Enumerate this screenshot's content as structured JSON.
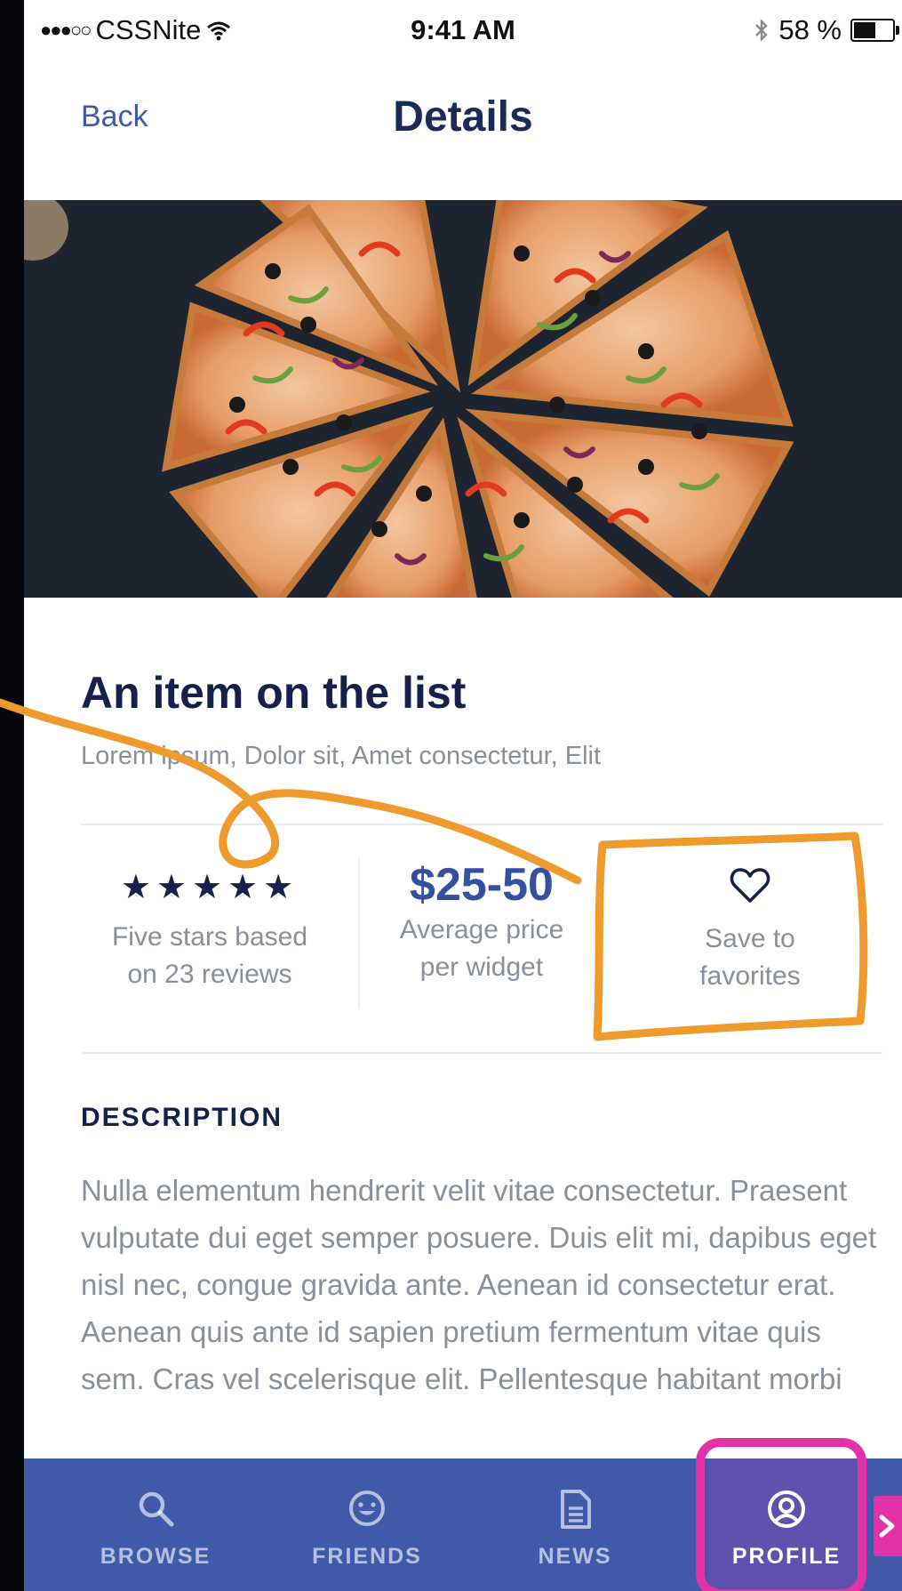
{
  "status_bar": {
    "signal_dots": "●●●○○",
    "carrier": "CSSNite",
    "time": "9:41 AM",
    "battery_text": "58 %",
    "battery_level": 0.58
  },
  "nav": {
    "back_label": "Back",
    "title": "Details"
  },
  "item": {
    "title": "An item on the list",
    "tags": "Lorem ipsum, Dolor sit, Amet consectetur, Elit"
  },
  "stats": {
    "rating_stars": "★★★★★",
    "rating_value": 5,
    "rating_caption_1": "Five stars based",
    "rating_caption_2": "on 23 reviews",
    "price": "$25-50",
    "price_caption_1": "Average price",
    "price_caption_2": "per widget",
    "favorite_caption_1": "Save to",
    "favorite_caption_2": "favorites"
  },
  "description": {
    "heading": "DESCRIPTION",
    "body": "Nulla elementum hendrerit velit vitae consectetur. Praesent vulputate dui eget semper posuere. Duis elit mi, dapibus eget nisl nec, congue gravida ante. Aenean id consectetur erat. Aenean quis ante id sapien pretium fermentum vitae quis sem. Cras vel scelerisque elit. Pellentesque habitant morbi"
  },
  "tabs": [
    {
      "label": "BROWSE",
      "icon": "search-icon"
    },
    {
      "label": "FRIENDS",
      "icon": "smiley-icon"
    },
    {
      "label": "NEWS",
      "icon": "document-icon"
    },
    {
      "label": "PROFILE",
      "icon": "user-circle-icon",
      "active": true
    }
  ],
  "colors": {
    "accent": "#3f5aa8",
    "title": "#14214c",
    "tab_active": "#6150ae",
    "annotation_orange": "#ee9a2c",
    "annotation_pink": "#e232a6"
  }
}
